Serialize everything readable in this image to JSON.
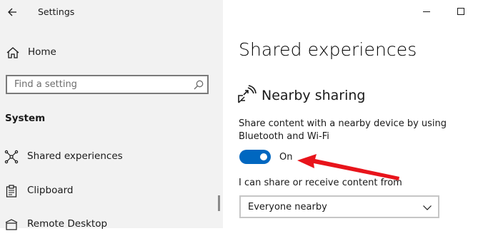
{
  "window": {
    "title": "Settings",
    "controls": [
      "minimize-icon",
      "maximize-icon"
    ]
  },
  "sidebar": {
    "home_label": "Home",
    "search_placeholder": "Find a setting",
    "section": "System",
    "items": [
      {
        "label": "Shared experiences",
        "icon": "shared-experiences-icon"
      },
      {
        "label": "Clipboard",
        "icon": "clipboard-icon"
      },
      {
        "label": "Remote Desktop",
        "icon": "remote-desktop-icon"
      }
    ]
  },
  "main": {
    "title": "Shared experiences",
    "nearby": {
      "heading": "Nearby sharing",
      "description": "Share content with a nearby device by using Bluetooth and Wi-Fi",
      "toggle_state": "On",
      "dropdown_label": "I can share or receive content from",
      "dropdown_value": "Everyone nearby"
    }
  },
  "colors": {
    "accent": "#0067c0",
    "annotation_arrow": "#e8141b",
    "sidebar_bg": "#f2f2f2"
  }
}
